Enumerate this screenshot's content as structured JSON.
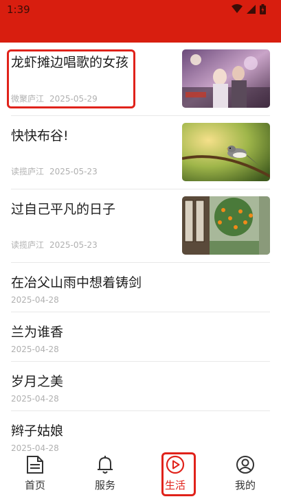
{
  "status_bar": {
    "time": "1:39"
  },
  "colors": {
    "header_red": "#d81e0f",
    "active_red": "#e0221a",
    "meta_gray": "#b0b0b0"
  },
  "feed": {
    "items": [
      {
        "title": "龙虾摊边唱歌的女孩",
        "source": "微聚庐江",
        "date": "2025-05-29",
        "thumbnail": "night-street-girls-photo"
      },
      {
        "title": "快快布谷!",
        "source": "读揽庐江",
        "date": "2025-05-23",
        "thumbnail": "bird-on-branch-photo"
      },
      {
        "title": "过自己平凡的日子",
        "source": "读揽庐江",
        "date": "2025-05-23",
        "thumbnail": "courtyard-orange-tree-photo"
      },
      {
        "title": "在冶父山雨中想着铸剑",
        "date": "2025-04-28"
      },
      {
        "title": "兰为谁香",
        "date": "2025-04-28"
      },
      {
        "title": "岁月之美",
        "date": "2025-04-28"
      },
      {
        "title": "辫子姑娘",
        "date": "2025-04-28"
      }
    ]
  },
  "bottom_nav": {
    "items": [
      {
        "label": "首页",
        "icon": "home-document-icon"
      },
      {
        "label": "服务",
        "icon": "bell-icon"
      },
      {
        "label": "生活",
        "icon": "play-circle-icon",
        "active": true
      },
      {
        "label": "我的",
        "icon": "user-circle-icon"
      }
    ]
  }
}
